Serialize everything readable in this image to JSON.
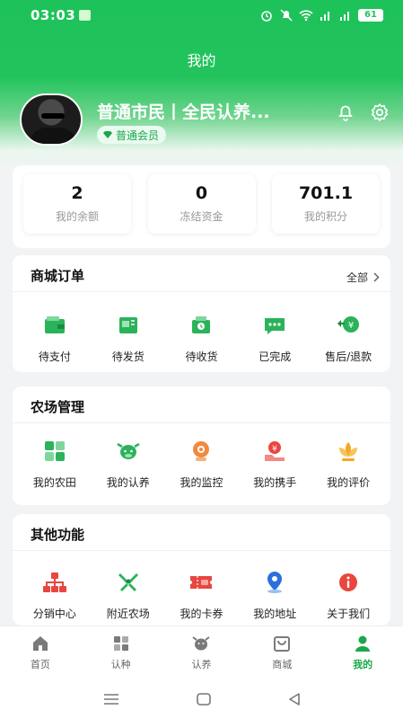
{
  "status_bar": {
    "time": "03:03",
    "battery": "61"
  },
  "header": {
    "title": "我的"
  },
  "profile": {
    "name": "普通市民丨全民认养...",
    "badge": "普通会员"
  },
  "stats": [
    {
      "value": "2",
      "label": "我的余额"
    },
    {
      "value": "0",
      "label": "冻结资金"
    },
    {
      "value": "701.1",
      "label": "我的积分"
    }
  ],
  "orders": {
    "title": "商城订单",
    "more": "全部",
    "items": [
      {
        "label": "待支付",
        "icon": "wallet-icon"
      },
      {
        "label": "待发货",
        "icon": "package-icon"
      },
      {
        "label": "待收货",
        "icon": "truck-icon"
      },
      {
        "label": "已完成",
        "icon": "chat-icon"
      },
      {
        "label": "售后/退款",
        "icon": "refund-icon"
      }
    ]
  },
  "farm": {
    "title": "农场管理",
    "items": [
      {
        "label": "我的农田",
        "icon": "field-icon"
      },
      {
        "label": "我的认养",
        "icon": "cow-icon"
      },
      {
        "label": "我的监控",
        "icon": "camera-icon"
      },
      {
        "label": "我的携手",
        "icon": "handshake-icon"
      },
      {
        "label": "我的评价",
        "icon": "lotus-icon"
      }
    ]
  },
  "other": {
    "title": "其他功能",
    "items": [
      {
        "label": "分销中心",
        "icon": "network-icon"
      },
      {
        "label": "附近农场",
        "icon": "windmill-icon"
      },
      {
        "label": "我的卡券",
        "icon": "ticket-icon"
      },
      {
        "label": "我的地址",
        "icon": "location-icon"
      },
      {
        "label": "关于我们",
        "icon": "info-icon"
      }
    ]
  },
  "tabbar": [
    {
      "label": "首页",
      "icon": "home-icon"
    },
    {
      "label": "认种",
      "icon": "plant-icon"
    },
    {
      "label": "认养",
      "icon": "cow-tab-icon"
    },
    {
      "label": "商城",
      "icon": "shop-icon"
    },
    {
      "label": "我的",
      "icon": "user-icon",
      "active": true
    }
  ],
  "colors": {
    "accent": "#1ec25a",
    "accent_dark": "#1aa84a"
  }
}
